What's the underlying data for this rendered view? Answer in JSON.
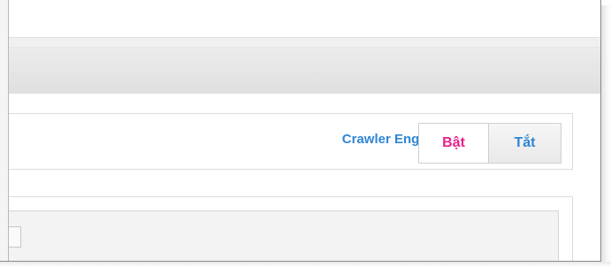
{
  "toolbar": {
    "crawler_label": "Crawler Engine:",
    "on_label": "Bật",
    "off_label": "Tắt"
  },
  "colors": {
    "label_blue": "#2f86d6",
    "active_pink": "#e8208c"
  }
}
